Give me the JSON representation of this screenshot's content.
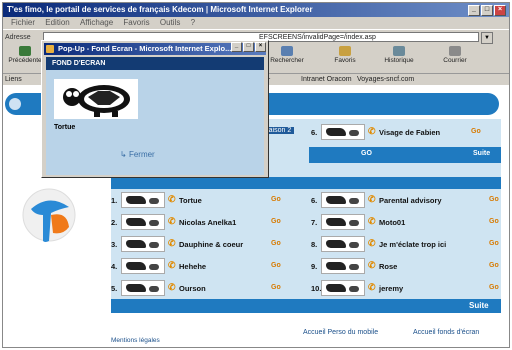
{
  "browser": {
    "title": "T'es fimo, le portail de services de français Kdecom | Microsoft Internet Explorer",
    "menu": [
      "Fichier",
      "Edition",
      "Affichage",
      "Favoris",
      "Outils",
      "?"
    ],
    "address_label": "Adresse",
    "address_value": "EFSCREENS/invalidPage=/index.asp",
    "toolbar": [
      {
        "label": "Précédente"
      },
      {
        "label": "Rechercher"
      },
      {
        "label": "Favoris"
      },
      {
        "label": "Historique"
      },
      {
        "label": "Courrier"
      }
    ],
    "links_label": "Liens",
    "links": [
      "Intranet Oracom",
      "Voyages-sncf.com"
    ]
  },
  "popup": {
    "title": "Pop-Up - Fond Ecran - Microsoft Internet Explo...",
    "header": "FOND D'ECRAN",
    "item_name": "Tortue",
    "close_label": "Fermer"
  },
  "page": {
    "top_item": {
      "num": "6.",
      "name": "Visage de Fabien",
      "go": "Go"
    },
    "saison_label": "Saison 2",
    "go_label": "GO",
    "suite_label": "Suite",
    "items_left": [
      {
        "num": "1.",
        "name": "Tortue",
        "go": "Go"
      },
      {
        "num": "2.",
        "name": "Nicolas Anelka1",
        "go": "Go"
      },
      {
        "num": "3.",
        "name": "Dauphine & coeur",
        "go": "Go"
      },
      {
        "num": "4.",
        "name": "Hehehe",
        "go": "Go"
      },
      {
        "num": "5.",
        "name": "Ourson",
        "go": "Go"
      }
    ],
    "items_right": [
      {
        "num": "6.",
        "name": "Parental advisory",
        "go": "Go"
      },
      {
        "num": "7.",
        "name": "Moto01",
        "go": "Go"
      },
      {
        "num": "8.",
        "name": "Je m'éclate trop ici",
        "go": "Go"
      },
      {
        "num": "9.",
        "name": "Rose",
        "go": "Go"
      },
      {
        "num": "10.",
        "name": "jeremy",
        "go": "Go"
      }
    ],
    "bottom_link_1": "Accueil Perso du mobile",
    "bottom_link_2": "Accueil fonds d'écran",
    "mentions": "Mentions légales"
  }
}
